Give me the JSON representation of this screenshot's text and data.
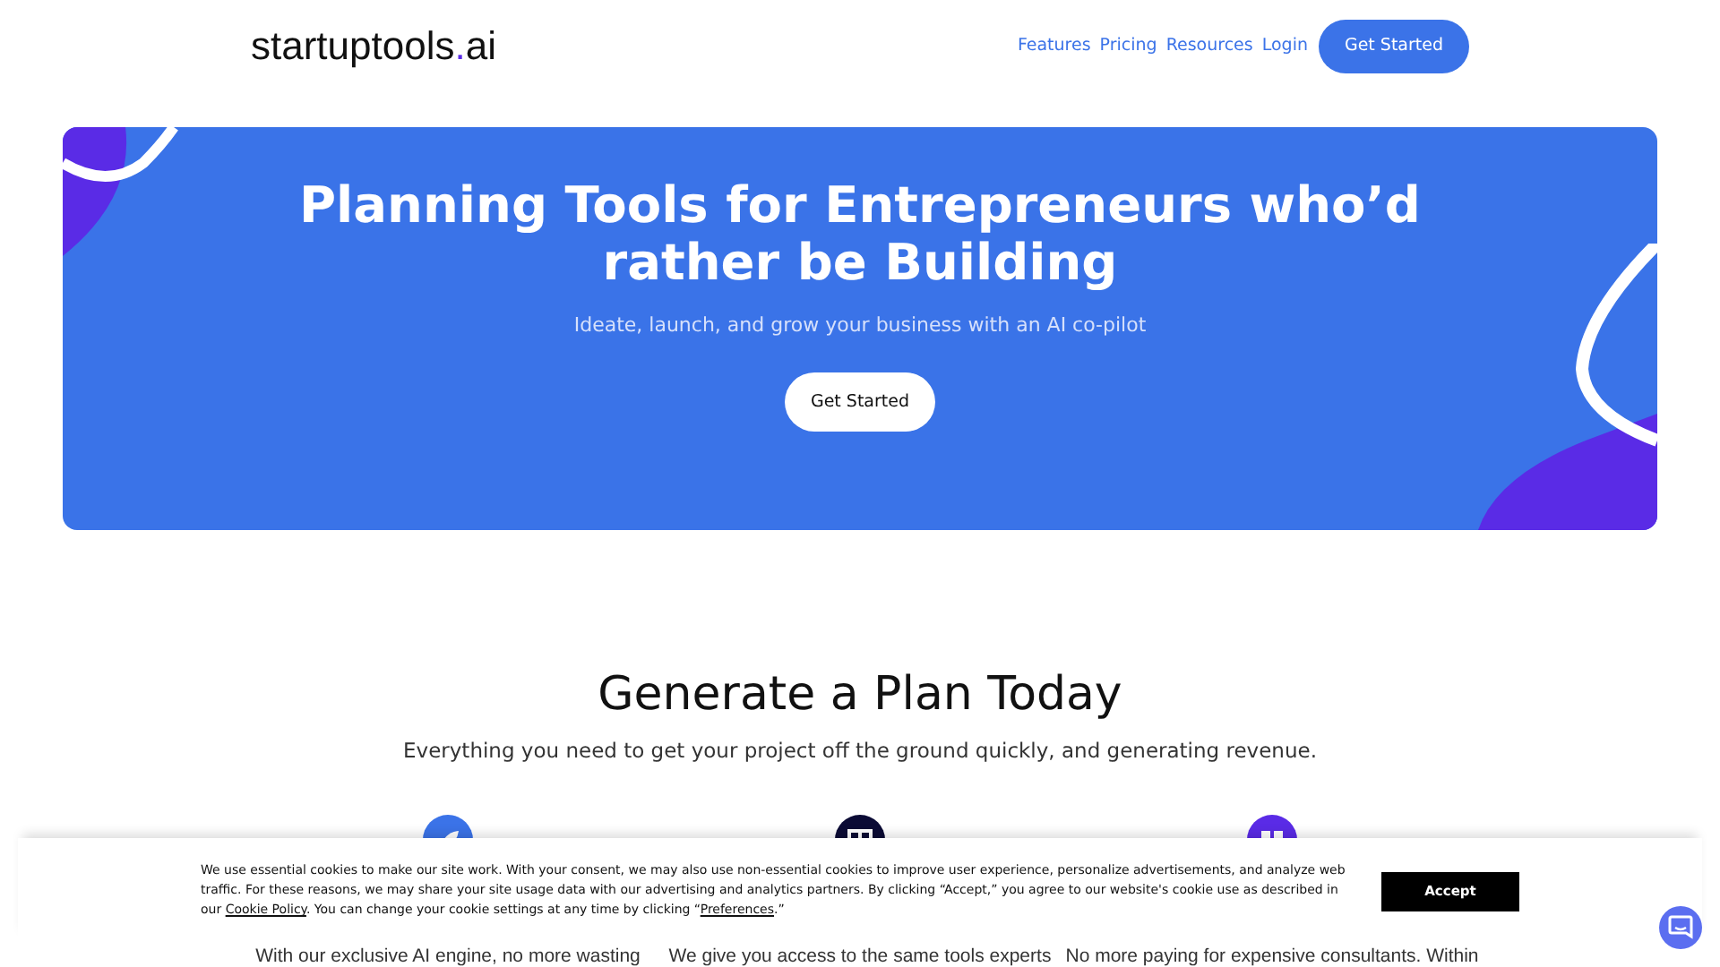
{
  "header": {
    "logo_name": "startuptools",
    "logo_dot": ".",
    "logo_tld": "ai",
    "nav": [
      "Features",
      "Pricing",
      "Resources",
      "Login"
    ],
    "cta": "Get Started"
  },
  "hero": {
    "title": "Planning Tools for Entrepreneurs who’d rather be Building",
    "subtitle": "Ideate, launch, and grow your business with an AI co-pilot",
    "cta": "Get Started"
  },
  "section": {
    "title": "Generate a Plan Today",
    "subtitle": "Everything you need to get your project off the ground quickly, and generating revenue."
  },
  "features": [
    {
      "color": "#3b73e8",
      "kind": "rocket",
      "text": "With our exclusive AI engine, no more wasting"
    },
    {
      "color": "#0b0b35",
      "kind": "layout",
      "text": "We give you access to the same tools experts"
    },
    {
      "color": "#5a2be6",
      "kind": "grid",
      "text": "No more paying for expensive consultants. Within"
    }
  ],
  "cookie_banner": {
    "text_before": "We use essential cookies to make our site work. With your consent, we may also use non-essential cookies to improve user experience, personalize advertisements, and analyze web traffic. For these reasons, we may share your site usage data with our advertising and analytics partners. By clicking “Accept,” you agree to our website's cookie use as described in our ",
    "policy_link": "Cookie Policy",
    "text_middle": ". You can change your cookie settings at any time by clicking “",
    "preferences_link": "Preferences",
    "text_after": ".”",
    "accept": "Accept"
  }
}
